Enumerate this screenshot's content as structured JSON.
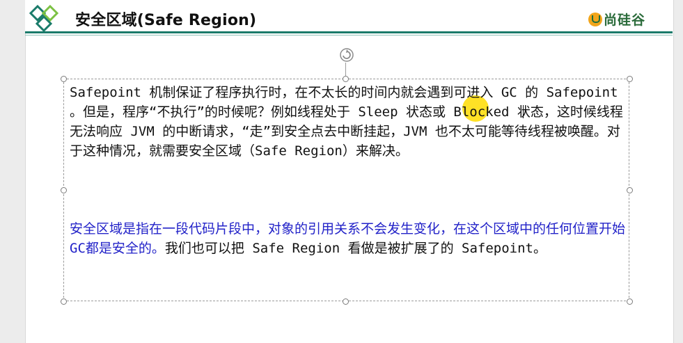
{
  "header": {
    "title": "安全区域(Safe Region)",
    "brand": "尚硅谷",
    "accent_color": "#1a7b6a",
    "logo_icon": "green-diamonds-logo"
  },
  "content": {
    "para1": "Safepoint 机制保证了程序执行时，在不太长的时间内就会遇到可进入 GC 的 Safepoint 。但是，程序“不执行”的时候呢？例如线程处于 Sleep 状态或 Blocked 状态，这时候线程无法响应 JVM 的中断请求，“走”到安全点去中断挂起，JVM 也不太可能等待线程被唤醒。对于这种情况，就需要安全区域（Safe Region）来解决。",
    "para2_blue": "安全区域是指在一段代码片段中，对象的引用关系不会发生变化，在这个区域中的任何位置开始GC都是安全的。",
    "para2_rest": "我们也可以把 Safe Region 看做是被扩展了的 Safepoint。",
    "highlight_color": "#2222c8"
  }
}
